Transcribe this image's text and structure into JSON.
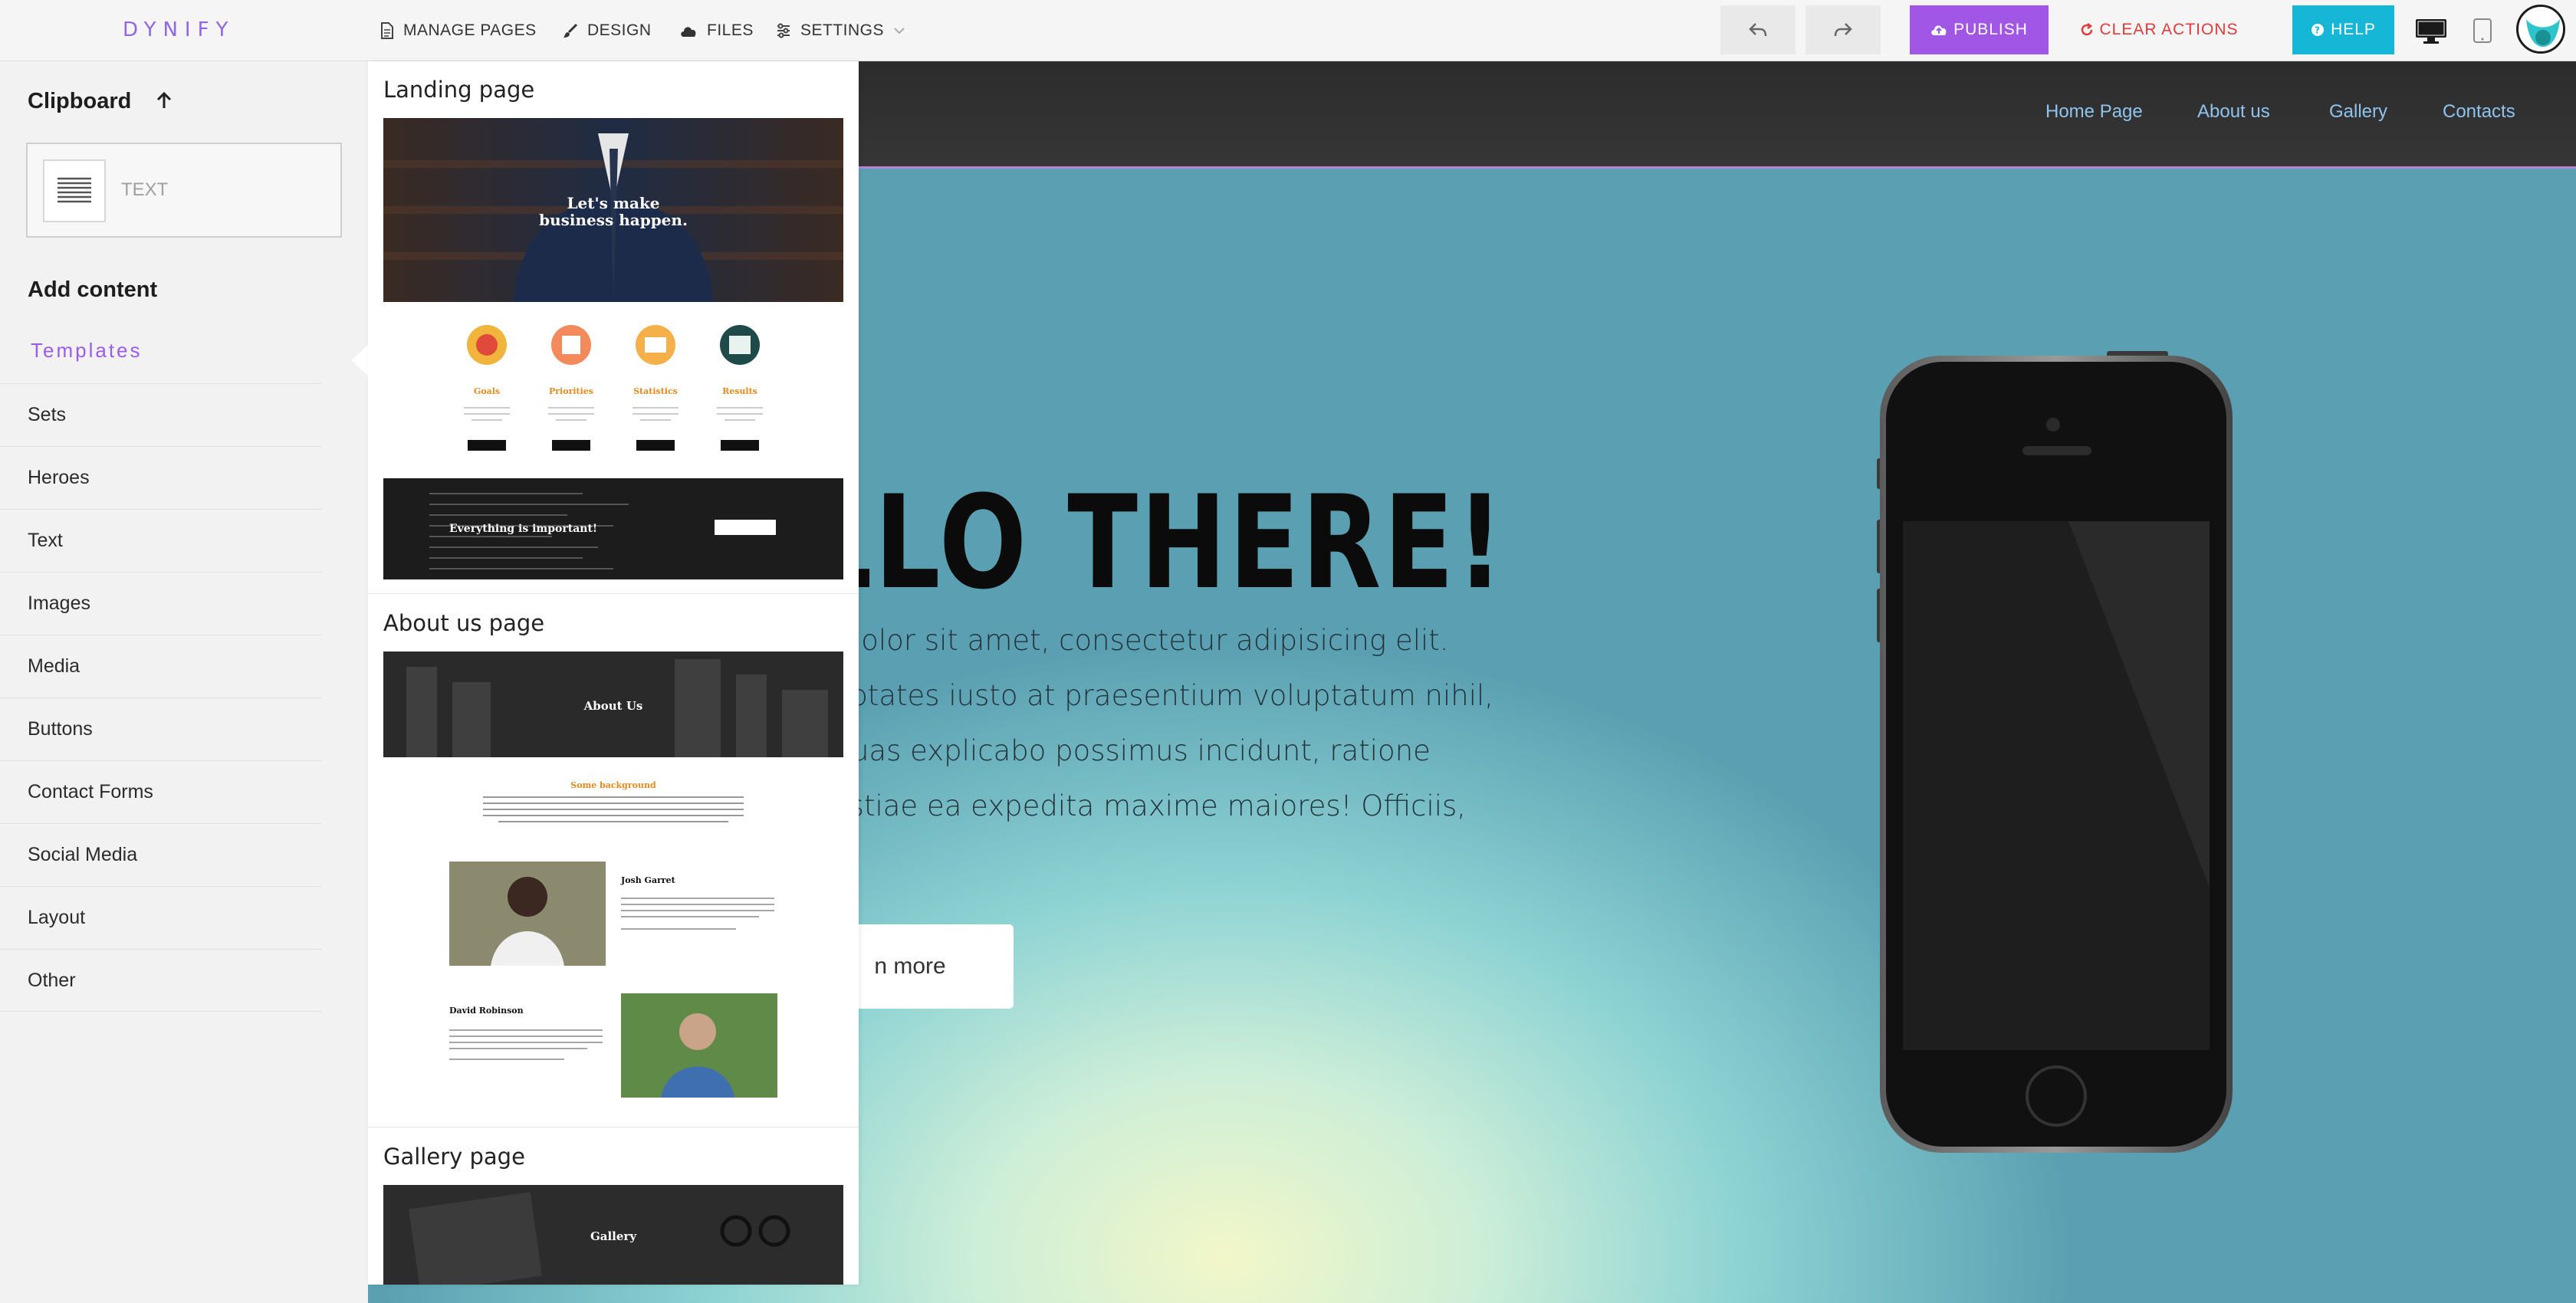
{
  "app": {
    "logo": "DYNIFY"
  },
  "topbar": {
    "menu": [
      {
        "label": "MANAGE PAGES",
        "icon": "page-icon"
      },
      {
        "label": "DESIGN",
        "icon": "brush-icon"
      },
      {
        "label": "FILES",
        "icon": "cloud-icon"
      },
      {
        "label": "SETTINGS",
        "icon": "sliders-icon"
      }
    ],
    "publish_label": "PUBLISH",
    "clear_label": "CLEAR ACTIONS",
    "help_label": "HELP",
    "colors": {
      "publish": "#a256e6",
      "help": "#15b6d6",
      "clear": "#e03b3b"
    }
  },
  "sidebar": {
    "clipboard_title": "Clipboard",
    "clipboard_item": "TEXT",
    "add_content_title": "Add content",
    "templates_label": "Templates",
    "items": [
      "Sets",
      "Heroes",
      "Text",
      "Images",
      "Media",
      "Buttons",
      "Contact Forms",
      "Social Media",
      "Layout",
      "Other"
    ]
  },
  "templates_panel": {
    "sections": [
      {
        "title": "Landing page",
        "hero_text": "Let's make business happen.",
        "features": [
          "Goals",
          "Priorities",
          "Statistics",
          "Results"
        ],
        "feature_button": "READ MORE",
        "banner_title": "Everything is important!",
        "banner_sub": "We don't leave any details behind. Everything is in good order!",
        "banner_button": "ABOUT US"
      },
      {
        "title": "About us page",
        "hero_text": "About Us",
        "subheading": "Some background",
        "people": [
          {
            "name": "Josh Garret",
            "role": "Lead designer"
          },
          {
            "name": "David Robinson",
            "role": "CEO"
          }
        ]
      },
      {
        "title": "Gallery page",
        "hero_text": "Gallery"
      }
    ]
  },
  "site": {
    "nav": [
      "Home Page",
      "About us",
      "Gallery",
      "Contacts"
    ],
    "headline": "LLO THERE!",
    "paragraph_lines": [
      "m dolor sit amet, consectetur adipisicing elit.",
      "oluptates iusto at praesentium voluptatum nihil,",
      "e quas explicabo possimus incidunt, ratione",
      "olestiae ea expedita maxime maiores! Officiis,"
    ],
    "cta_label": "n more"
  }
}
